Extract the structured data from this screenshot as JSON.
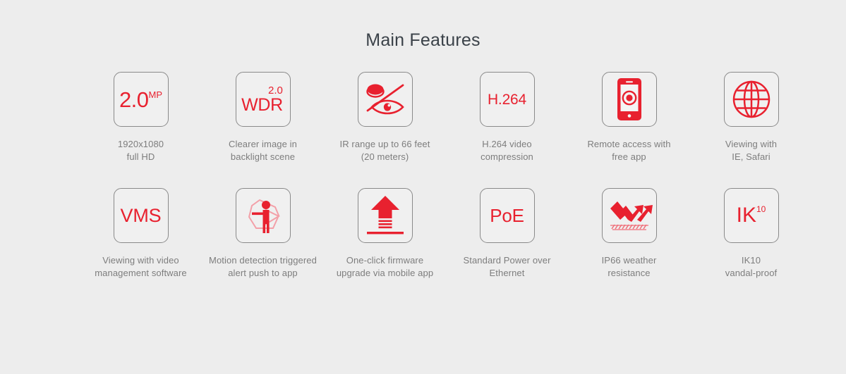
{
  "header": {
    "title": "Main Features"
  },
  "colors": {
    "accent_red": "#e8212f",
    "background": "#ededed",
    "tile_fill": "#f0f0f0",
    "tile_border": "#8a8a8a",
    "caption_text": "#7d7d7d",
    "title_text": "#3b4249"
  },
  "features": [
    {
      "id": "resolution",
      "icon": "2mp-text-icon",
      "glyph_main": "2.0",
      "glyph_sup": "MP",
      "caption": "1920x1080\nfull HD"
    },
    {
      "id": "wdr",
      "icon": "wdr-text-icon",
      "glyph_top": "2.0",
      "glyph_main": "WDR",
      "caption": "Clearer image in\nbacklight scene"
    },
    {
      "id": "ir-range",
      "icon": "night-vision-eye-icon",
      "caption": "IR range up to 66 feet\n(20 meters)"
    },
    {
      "id": "compression",
      "icon": "h264-text-icon",
      "glyph_main": "H.264",
      "caption": "H.264 video\ncompression"
    },
    {
      "id": "remote-access",
      "icon": "smartphone-icon",
      "caption": "Remote access with\nfree app"
    },
    {
      "id": "browser-viewing",
      "icon": "globe-icon",
      "caption": "Viewing with\nIE, Safari"
    },
    {
      "id": "vms",
      "icon": "vms-text-icon",
      "glyph_main": "VMS",
      "caption": "Viewing with video\nmanagement software"
    },
    {
      "id": "motion-detection",
      "icon": "motion-detection-person-icon",
      "caption": "Motion detection triggered\nalert push to app"
    },
    {
      "id": "firmware-upgrade",
      "icon": "upload-arrow-icon",
      "caption": "One-click firmware\nupgrade via mobile app"
    },
    {
      "id": "poe",
      "icon": "poe-text-icon",
      "glyph_main": "PoE",
      "caption": "Standard Power over\nEthernet"
    },
    {
      "id": "ip66",
      "icon": "weather-resistance-arrows-icon",
      "caption": "IP66 weather\nresistance"
    },
    {
      "id": "ik10",
      "icon": "ik10-text-icon",
      "glyph_main": "IK",
      "glyph_sup": "10",
      "caption": "IK10\nvandal-proof"
    }
  ]
}
